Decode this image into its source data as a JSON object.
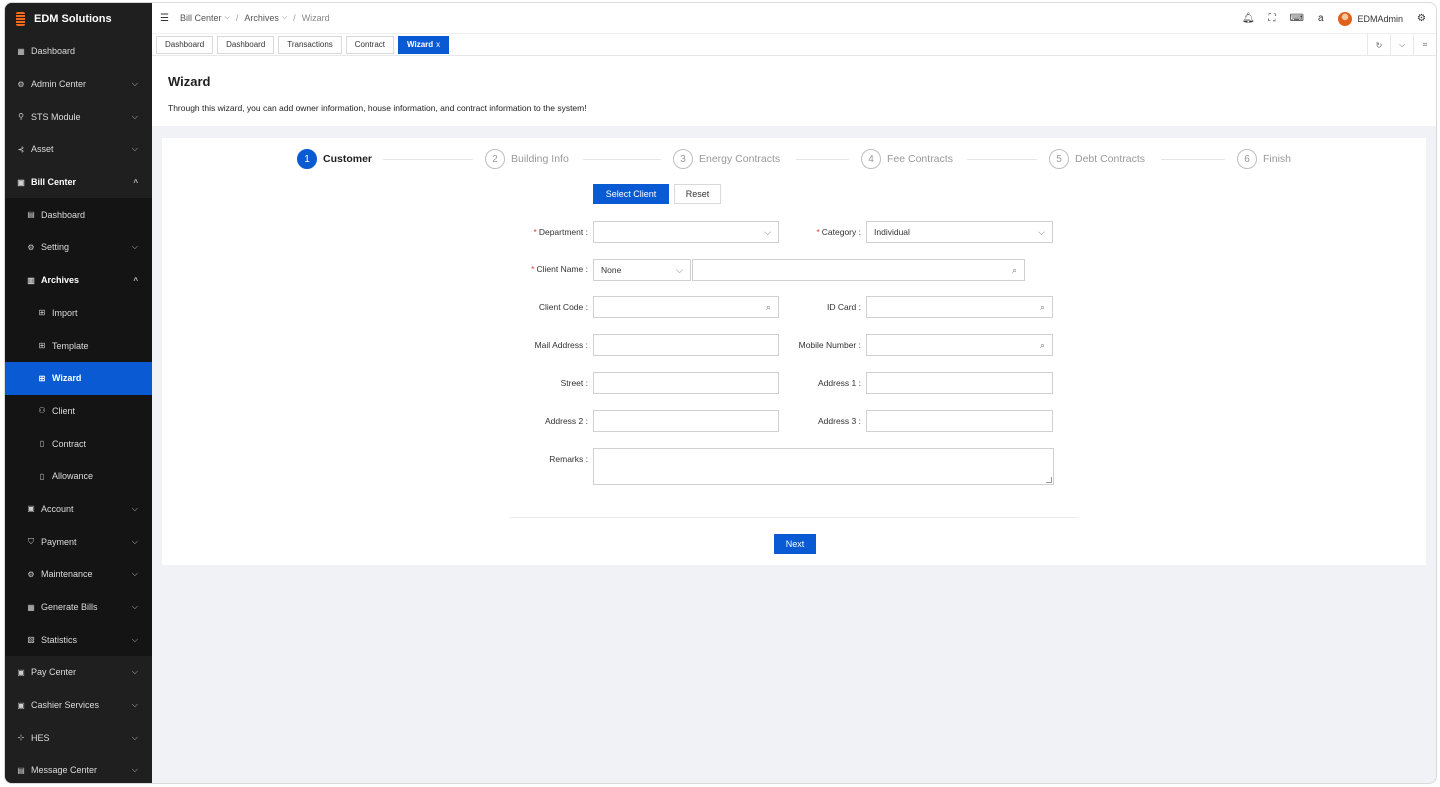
{
  "app": {
    "name": "EDM Solutions"
  },
  "sidebar": {
    "items": [
      {
        "label": "Dashboard",
        "icon": "calendar-icon",
        "level": 1,
        "chevron": ""
      },
      {
        "label": "Admin Center",
        "icon": "gear-icon",
        "level": 1,
        "chevron": "⌵"
      },
      {
        "label": "STS Module",
        "icon": "key-icon",
        "level": 1,
        "chevron": "⌵"
      },
      {
        "label": "Asset",
        "icon": "asset-icon",
        "level": 1,
        "chevron": "⌵"
      },
      {
        "label": "Bill Center",
        "icon": "bill-icon",
        "level": 1,
        "chevron": "^",
        "bold": true
      },
      {
        "label": "Dashboard",
        "icon": "chart-icon",
        "level": 2,
        "chevron": ""
      },
      {
        "label": "Setting",
        "icon": "gear-icon",
        "level": 2,
        "chevron": "⌵"
      },
      {
        "label": "Archives",
        "icon": "archive-icon",
        "level": 2,
        "chevron": "^",
        "bold": true
      },
      {
        "label": "Import",
        "icon": "grid-icon",
        "level": 3,
        "chevron": ""
      },
      {
        "label": "Template",
        "icon": "grid-icon",
        "level": 3,
        "chevron": ""
      },
      {
        "label": "Wizard",
        "icon": "grid-icon",
        "level": 3,
        "chevron": "",
        "active": true
      },
      {
        "label": "Client",
        "icon": "user-icon",
        "level": 3,
        "chevron": ""
      },
      {
        "label": "Contract",
        "icon": "file-icon",
        "level": 3,
        "chevron": ""
      },
      {
        "label": "Allowance",
        "icon": "file-icon",
        "level": 3,
        "chevron": ""
      },
      {
        "label": "Account",
        "icon": "account-icon",
        "level": 2,
        "chevron": "⌵"
      },
      {
        "label": "Payment",
        "icon": "shield-icon",
        "level": 2,
        "chevron": "⌵"
      },
      {
        "label": "Maintenance",
        "icon": "gear-icon",
        "level": 2,
        "chevron": "⌵"
      },
      {
        "label": "Generate Bills",
        "icon": "table-icon",
        "level": 2,
        "chevron": "⌵"
      },
      {
        "label": "Statistics",
        "icon": "stats-icon",
        "level": 2,
        "chevron": "⌵"
      },
      {
        "label": "Pay Center",
        "icon": "bill-icon",
        "level": 1,
        "chevron": "⌵"
      },
      {
        "label": "Cashier Services",
        "icon": "bill-icon",
        "level": 1,
        "chevron": "⌵"
      },
      {
        "label": "HES",
        "icon": "network-icon",
        "level": 1,
        "chevron": "⌵"
      },
      {
        "label": "Message Center",
        "icon": "chart-icon",
        "level": 1,
        "chevron": "⌵"
      }
    ]
  },
  "header": {
    "breadcrumb": [
      "Bill Center",
      "Archives",
      "Wizard"
    ],
    "user": "EDMAdmin"
  },
  "tabs": [
    {
      "label": "Dashboard",
      "active": false
    },
    {
      "label": "Dashboard",
      "active": false
    },
    {
      "label": "Transactions",
      "active": false
    },
    {
      "label": "Contract",
      "active": false
    },
    {
      "label": "Wizard",
      "active": true,
      "close": "x"
    }
  ],
  "page": {
    "title": "Wizard",
    "description": "Through this wizard, you can add owner information, house information, and contract information to the system!"
  },
  "steps": [
    {
      "num": "1",
      "label": "Customer",
      "active": true
    },
    {
      "num": "2",
      "label": "Building Info",
      "active": false
    },
    {
      "num": "3",
      "label": "Energy Contracts",
      "active": false
    },
    {
      "num": "4",
      "label": "Fee Contracts",
      "active": false
    },
    {
      "num": "5",
      "label": "Debt Contracts",
      "active": false
    },
    {
      "num": "6",
      "label": "Finish",
      "active": false
    }
  ],
  "actions": {
    "select_client": "Select Client",
    "reset": "Reset",
    "next": "Next"
  },
  "form": {
    "department": {
      "label": "Department",
      "value": ""
    },
    "category": {
      "label": "Category",
      "value": "Individual"
    },
    "client_name": {
      "label": "Client Name",
      "type_value": "None",
      "value": ""
    },
    "client_code": {
      "label": "Client Code",
      "value": ""
    },
    "id_card": {
      "label": "ID Card",
      "value": ""
    },
    "mail_address": {
      "label": "Mail Address",
      "value": ""
    },
    "mobile_number": {
      "label": "Mobile Number",
      "value": ""
    },
    "street": {
      "label": "Street",
      "value": ""
    },
    "address1": {
      "label": "Address 1",
      "value": ""
    },
    "address2": {
      "label": "Address 2",
      "value": ""
    },
    "address3": {
      "label": "Address 3",
      "value": ""
    },
    "remarks": {
      "label": "Remarks",
      "value": ""
    }
  },
  "colors": {
    "primary": "#0a5bd3",
    "sidebar": "#1f1f1f",
    "required": "#e03b3b",
    "brand": "#f26b1d"
  }
}
